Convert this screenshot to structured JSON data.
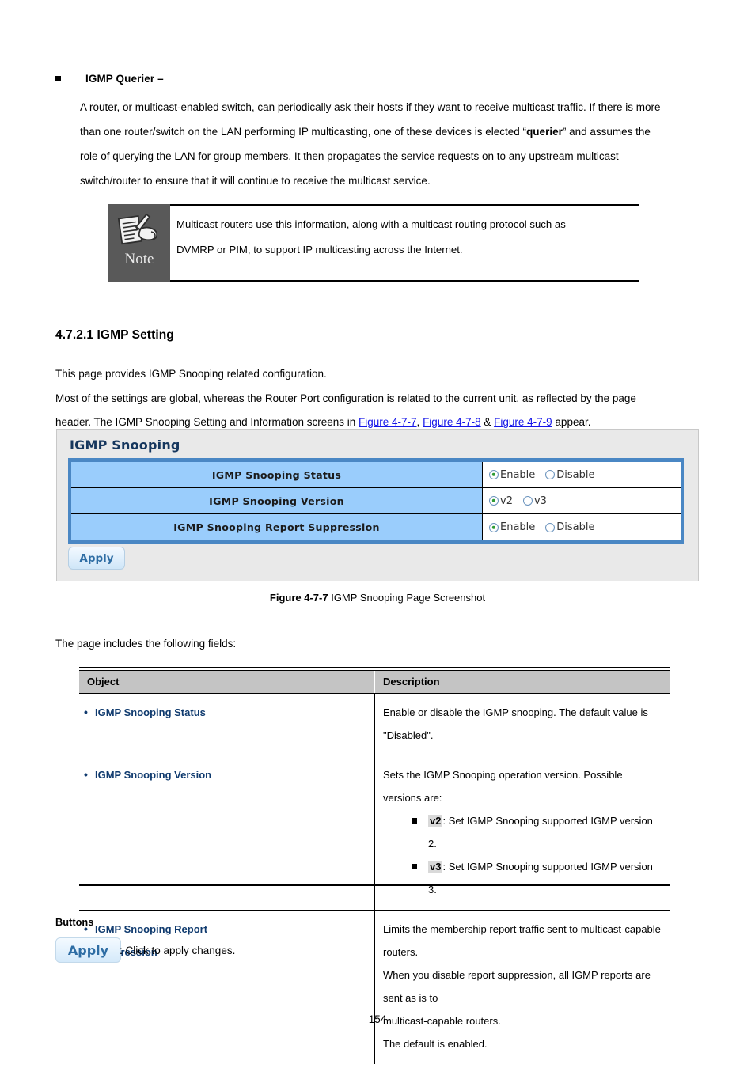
{
  "section_bullet": {
    "label": "IGMP Querier –",
    "paragraph_lines": [
      "A router, or multicast-enabled switch, can periodically ask their hosts if they want to receive multicast traffic. If there is more",
      "than one router/switch on the LAN performing IP multicasting, one of these devices is elected “querier” and assumes the",
      "role of querying the LAN for group members. It then propagates the service requests on to any upstream multicast",
      "switch/router to ensure that it will continue to receive the multicast service."
    ],
    "emphasis_word": "querier"
  },
  "note": {
    "icon_label": "Note",
    "line1": "Multicast routers use this information, along with a multicast routing protocol such as",
    "line2": "DVMRP or PIM, to support IP multicasting across the Internet."
  },
  "section": {
    "heading": "4.7.2.1 IGMP Setting",
    "intro_line1": "This page provides IGMP Snooping related configuration.",
    "intro_line2": "Most of the settings are global, whereas the Router Port configuration is related to the current unit, as reflected by the page",
    "intro_line3_pre": "header. The IGMP Snooping Setting and Information screens in ",
    "link1": "Figure 4-7-7",
    "sep1": ", ",
    "link2": "Figure 4-7-8",
    "sep2": " & ",
    "link3": "Figure 4-7-9",
    "intro_line3_post": " appear."
  },
  "screenshot": {
    "title": "IGMP Snooping",
    "rows": [
      {
        "label": "IGMP Snooping Status",
        "options": [
          {
            "label": "Enable",
            "selected": true
          },
          {
            "label": "Disable",
            "selected": false
          }
        ]
      },
      {
        "label": "IGMP Snooping Version",
        "options": [
          {
            "label": "v2",
            "selected": true
          },
          {
            "label": "v3",
            "selected": false
          }
        ]
      },
      {
        "label": "IGMP Snooping Report Suppression",
        "options": [
          {
            "label": "Enable",
            "selected": true
          },
          {
            "label": "Disable",
            "selected": false
          }
        ]
      }
    ],
    "apply_label": "Apply",
    "colors": {
      "panel_bg": "#e9e9e9",
      "label_cell": "#9acdfc",
      "table_frame": "#4a87c4",
      "title_text": "#16375e",
      "radio_dot": "#2e9b34",
      "button_text": "#2e6da4"
    }
  },
  "figure_caption": {
    "bold": "Figure 4-7-7",
    "rest": " IGMP Snooping Page Screenshot"
  },
  "includes_line": "The page includes the following fields:",
  "desc_table": {
    "headers": [
      "Object",
      "Description"
    ],
    "rows": [
      {
        "object_lines": [
          "IGMP Snooping Status"
        ],
        "description_lines": [
          "Enable or disable the IGMP snooping. The default value is \"Disabled\"."
        ],
        "sub_items": []
      },
      {
        "object_lines": [
          "IGMP Snooping Version"
        ],
        "description_lines": [
          "Sets the IGMP Snooping operation version. Possible versions are:"
        ],
        "sub_items": [
          {
            "code": "v2",
            "text": ": Set IGMP Snooping supported IGMP version 2."
          },
          {
            "code": "v3",
            "text": ": Set IGMP Snooping supported IGMP version 3."
          }
        ]
      },
      {
        "object_lines": [
          "IGMP Snooping Report",
          "Suppression"
        ],
        "description_lines": [
          "Limits the membership report traffic sent to multicast-capable routers.",
          "When you disable report suppression, all IGMP reports are sent as is to",
          "multicast-capable routers.",
          "The default is enabled."
        ],
        "sub_items": []
      }
    ],
    "object_color": "#0f3a6e"
  },
  "buttons_section": {
    "heading": "Buttons",
    "apply_label": "Apply",
    "caption": ": Click to apply changes."
  },
  "page_number": "154"
}
